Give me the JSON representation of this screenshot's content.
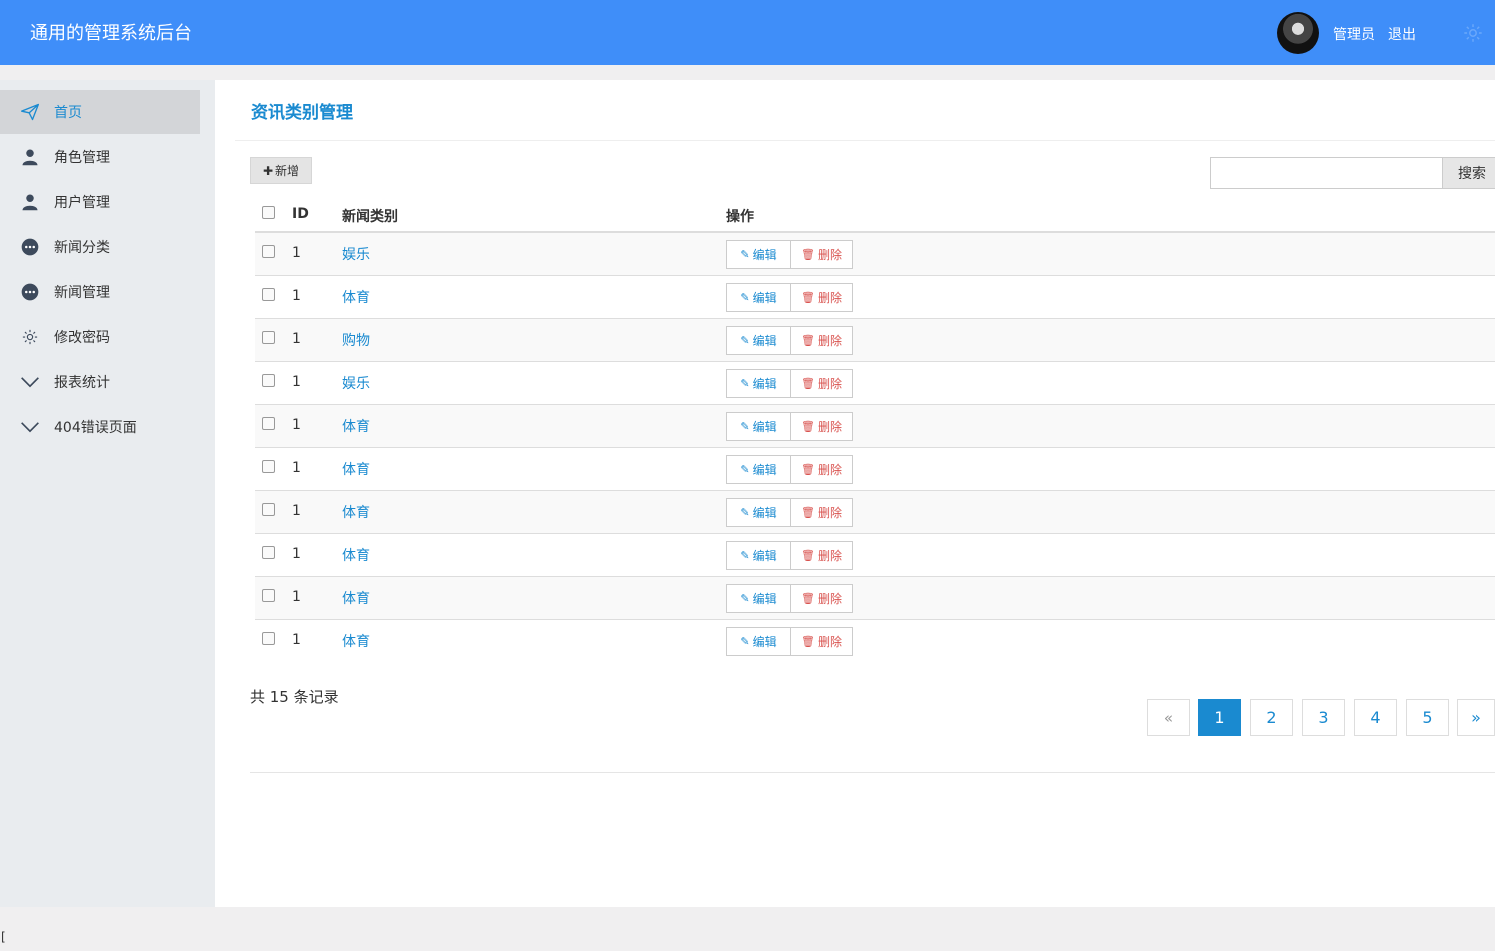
{
  "app": {
    "title": "通用的管理系统后台",
    "user_name": "管理员",
    "logout_label": "退出"
  },
  "sidebar": {
    "items": [
      {
        "label": "首页",
        "icon": "paper-plane-icon",
        "active": true
      },
      {
        "label": "角色管理",
        "icon": "user-icon"
      },
      {
        "label": "用户管理",
        "icon": "user-icon"
      },
      {
        "label": "新闻分类",
        "icon": "chat-bubble-icon"
      },
      {
        "label": "新闻管理",
        "icon": "chat-bubble-icon"
      },
      {
        "label": "修改密码",
        "icon": "gear-icon"
      },
      {
        "label": "报表统计",
        "icon": "chevron-down-icon"
      },
      {
        "label": "404错误页面",
        "icon": "chevron-down-icon"
      }
    ]
  },
  "main": {
    "page_title": "资讯类别管理",
    "add_label": "新增",
    "search_placeholder": "",
    "search_label": "搜索",
    "table": {
      "headers": {
        "id": "ID",
        "category": "新闻类别",
        "actions": "操作"
      },
      "edit_label": "编辑",
      "delete_label": "删除",
      "rows": [
        {
          "id": "1",
          "category": "娱乐"
        },
        {
          "id": "1",
          "category": "体育"
        },
        {
          "id": "1",
          "category": "购物"
        },
        {
          "id": "1",
          "category": "娱乐"
        },
        {
          "id": "1",
          "category": "体育"
        },
        {
          "id": "1",
          "category": "体育"
        },
        {
          "id": "1",
          "category": "体育"
        },
        {
          "id": "1",
          "category": "体育"
        },
        {
          "id": "1",
          "category": "体育"
        },
        {
          "id": "1",
          "category": "体育"
        }
      ]
    },
    "total_text": "共 15 条记录",
    "pagination": {
      "prev": "«",
      "pages": [
        "1",
        "2",
        "3",
        "4",
        "5"
      ],
      "current": "1",
      "next": "»"
    }
  },
  "footer": {
    "corner_text": "["
  },
  "colors": {
    "header_bg": "#3f8ef9",
    "accent": "#1a8ad0",
    "danger": "#d9534f"
  }
}
